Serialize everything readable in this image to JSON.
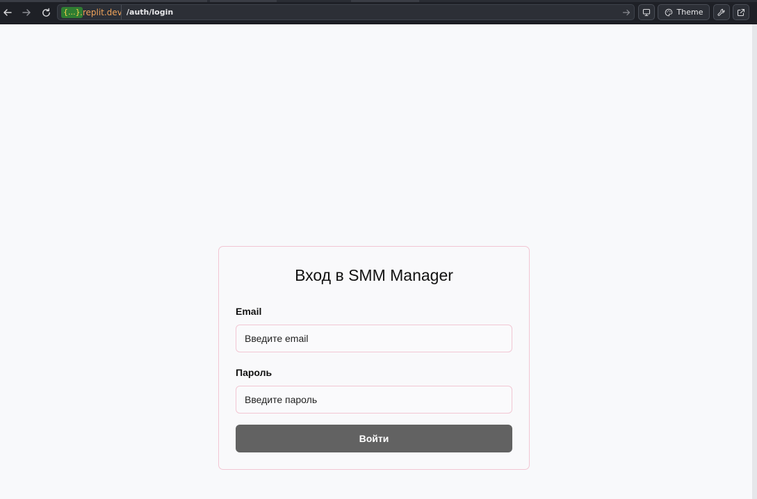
{
  "browser": {
    "url_badge": "{...}",
    "url_domain": ".replit.dev",
    "url_path": "/auth/login",
    "theme_label": "Theme",
    "icons": [
      "back-arrow-icon",
      "forward-arrow-icon",
      "reload-icon",
      "go-arrow-icon",
      "monitor-icon",
      "palette-icon",
      "wrench-icon",
      "external-link-icon"
    ]
  },
  "login": {
    "title": "Вход в SMM Manager",
    "email_label": "Email",
    "email_placeholder": "Введите email",
    "email_value": "",
    "password_label": "Пароль",
    "password_placeholder": "Введите пароль",
    "password_value": "",
    "submit_label": "Войти"
  },
  "colors": {
    "page_background": "#f8f9fb",
    "card_border": "#f2c6d3",
    "button_background": "#626262",
    "chrome_background": "#1e2026",
    "domain_text": "#f0a35a",
    "badge_background": "#2f7d32"
  }
}
